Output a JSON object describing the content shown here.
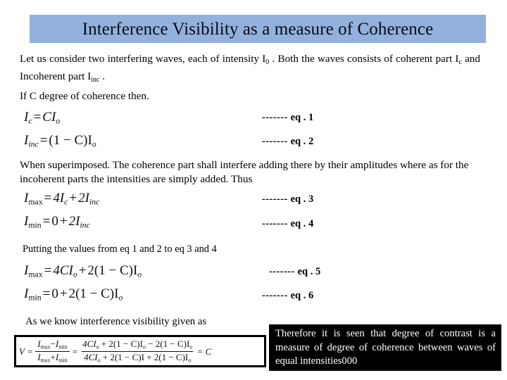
{
  "slide": {
    "title": "Interference Visibility as a measure of Coherence",
    "title_band_color": "#92b1dd",
    "background_color": "#ffffff"
  },
  "paragraphs": {
    "intro_a": "Let us consider two interfering waves, each of intensity I",
    "intro_a_sub": "0",
    "intro_b": " . Both the waves consists of coherent part I",
    "intro_b_sub": "c",
    "intro_c": "  and Incoherent part I",
    "intro_c_sub": "inc",
    "intro_d": " .",
    "if_c": "If C degree of coherence then.",
    "superimposed": "When superimposed. The coherence part shall interfere adding there by their amplitudes where as for the incoherent parts the intensities are simply added. Thus",
    "putting": "Putting the values from eq 1 and 2 to eq 3 and 4",
    "visibility_intro": "As we know interference visibility given as"
  },
  "equations": [
    {
      "id": "eq1",
      "lhs_var": "I",
      "lhs_sub": "c",
      "rhs": "CI",
      "rhs_sub": "o",
      "label_dashes": "-------",
      "label_text": "eq . 1"
    },
    {
      "id": "eq2",
      "lhs_var": "I",
      "lhs_sub": "inc",
      "rhs": "(1 − C)I",
      "rhs_sub": "o",
      "label_dashes": "-------",
      "label_text": "eq . 2"
    },
    {
      "id": "eq3",
      "lhs_var": "I",
      "lhs_sub": "max",
      "rhs_term1": "4I",
      "rhs_term1_sub": "c",
      "rhs_term2": "2I",
      "rhs_term2_sub": "inc",
      "label_dashes": "-------",
      "label_text": "eq . 3"
    },
    {
      "id": "eq4",
      "lhs_var": "I",
      "lhs_sub": "min",
      "rhs_term1": "0",
      "rhs_term2": "2I",
      "rhs_term2_sub": "inc",
      "label_dashes": "-------",
      "label_text": "eq . 4"
    },
    {
      "id": "eq5",
      "lhs_var": "I",
      "lhs_sub": "max",
      "rhs_term1": "4CI",
      "rhs_term1_sub": "o",
      "rhs_term2": "2(1 − C)I",
      "rhs_term2_sub": "o",
      "label_dashes": "-------",
      "label_text": "eq . 5"
    },
    {
      "id": "eq6",
      "lhs_var": "I",
      "lhs_sub": "min",
      "rhs_term1": "0",
      "rhs_term2": "2(1 − C)I",
      "rhs_term2_sub": "o",
      "label_dashes": "-------",
      "label_text": "eq . 6"
    }
  ],
  "visibility_formula": {
    "v_symbol": "V",
    "equals_1": "=",
    "frac1_num_a": "I",
    "frac1_num_a_sub": "max",
    "frac1_num_op": "−",
    "frac1_num_b": "I",
    "frac1_num_b_sub": "min",
    "frac1_den_a": "I",
    "frac1_den_a_sub": "max",
    "frac1_den_op": "+",
    "frac1_den_b": "I",
    "frac1_den_b_sub": "min",
    "equals_2": "=",
    "frac2_num": "4CI",
    "frac2_num_sub": "o",
    "frac2_num_rest_a": " + 2(1 − C)I",
    "frac2_num_rest_a_sub": "o",
    "frac2_num_rest_b": " − 2(1 − C)I",
    "frac2_num_rest_b_sub": "o",
    "frac2_den": "4CI",
    "frac2_den_sub": "o",
    "frac2_den_rest_a": " + 2(1 − C)I",
    "frac2_den_rest_b": " + 2(1 − C)I",
    "frac2_den_rest_b_sub": "o",
    "equals_3": "=",
    "result": "C"
  },
  "conclusion": {
    "text": "Therefore it is seen that degree of contrast is a measure of degree of coherence between waves of equal intensities000",
    "background_color": "#000000",
    "text_color": "#ffffff"
  }
}
